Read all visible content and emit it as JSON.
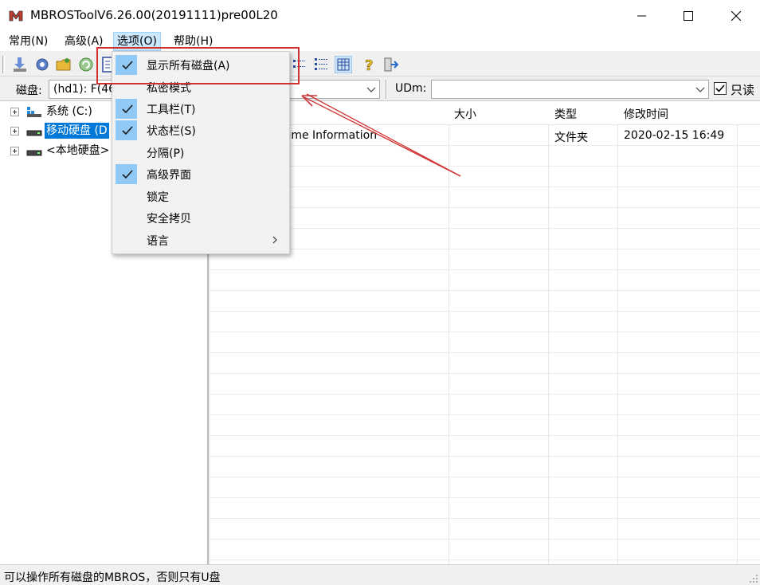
{
  "window": {
    "title": "MBROSToolV6.26.00(20191111)pre00L20"
  },
  "menubar": {
    "items": [
      {
        "label": "常用(N)"
      },
      {
        "label": "高级(A)"
      },
      {
        "label": "选项(O)"
      },
      {
        "label": "帮助(H)"
      }
    ]
  },
  "diskbar": {
    "disk_label": "磁盘:",
    "disk_value": "(hd1): F(46",
    "udm_label": "UDm:",
    "readonly_label": "只读"
  },
  "tree": {
    "items": [
      {
        "label": "系统 (C:)"
      },
      {
        "label": "移动硬盘 (D"
      },
      {
        "label": "<本地硬盘>"
      }
    ]
  },
  "list": {
    "columns": {
      "size": "大小",
      "type": "类型",
      "modified": "修改时间"
    },
    "rows": [
      {
        "name": "olume Information",
        "type": "文件夹",
        "modified": "2020-02-15 16:49"
      }
    ]
  },
  "options_menu": {
    "items": [
      {
        "label": "显示所有磁盘(A)",
        "checked": true
      },
      {
        "label": "私密模式",
        "checked": false
      },
      {
        "label": "工具栏(T)",
        "checked": true
      },
      {
        "label": "状态栏(S)",
        "checked": true
      },
      {
        "label": "分隔(P)",
        "checked": false
      },
      {
        "label": "高级界面",
        "checked": true
      },
      {
        "label": "锁定",
        "checked": false
      },
      {
        "label": "安全拷贝",
        "checked": false
      },
      {
        "label": "语言",
        "checked": false,
        "submenu": true
      }
    ]
  },
  "statusbar": {
    "text": "可以操作所有磁盘的MBROS，否则只有U盘"
  },
  "colors": {
    "selection": "#0078d7",
    "menu_check_bg": "#90c8f6",
    "annotation": "#d03030"
  }
}
